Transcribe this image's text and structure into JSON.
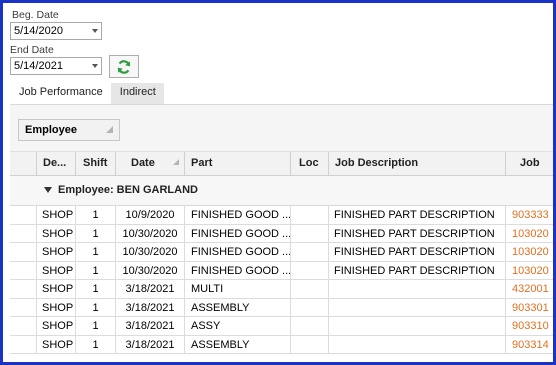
{
  "filters": {
    "beg_date_label": "Beg. Date",
    "beg_date_value": "5/14/2020",
    "end_date_label": "End Date",
    "end_date_value": "5/14/2021"
  },
  "icons": {
    "refresh": "refresh-icon",
    "dropdown": "chevron-down-icon",
    "expand": "triangle-down-icon",
    "sort": "sort-icon"
  },
  "colors": {
    "frame": "#1a33c4",
    "link": "#e07020",
    "refresh_green": "#2e9e3e"
  },
  "tabs": [
    {
      "label": "Job Performance",
      "active": true
    },
    {
      "label": "Indirect",
      "active": false
    }
  ],
  "group_panel": {
    "chip_label": "Employee"
  },
  "grid": {
    "columns": [
      "De...",
      "Shift",
      "Date",
      "Part",
      "Loc",
      "Job Description",
      "Job"
    ],
    "group_row": "Employee: BEN GARLAND",
    "rows": [
      {
        "dept": "SHOP",
        "shift": "1",
        "date": "10/9/2020",
        "part": "FINISHED GOOD ...",
        "loc": "",
        "desc": "FINISHED PART DESCRIPTION",
        "job": "903333"
      },
      {
        "dept": "SHOP",
        "shift": "1",
        "date": "10/30/2020",
        "part": "FINISHED GOOD ...",
        "loc": "",
        "desc": "FINISHED PART DESCRIPTION",
        "job": "103020"
      },
      {
        "dept": "SHOP",
        "shift": "1",
        "date": "10/30/2020",
        "part": "FINISHED GOOD ...",
        "loc": "",
        "desc": "FINISHED PART DESCRIPTION",
        "job": "103020"
      },
      {
        "dept": "SHOP",
        "shift": "1",
        "date": "10/30/2020",
        "part": "FINISHED GOOD ...",
        "loc": "",
        "desc": "FINISHED PART DESCRIPTION",
        "job": "103020"
      },
      {
        "dept": "SHOP",
        "shift": "1",
        "date": "3/18/2021",
        "part": "MULTI",
        "loc": "",
        "desc": "",
        "job": "432001"
      },
      {
        "dept": "SHOP",
        "shift": "1",
        "date": "3/18/2021",
        "part": "ASSEMBLY",
        "loc": "",
        "desc": "",
        "job": "903301"
      },
      {
        "dept": "SHOP",
        "shift": "1",
        "date": "3/18/2021",
        "part": "ASSY",
        "loc": "",
        "desc": "",
        "job": "903310"
      },
      {
        "dept": "SHOP",
        "shift": "1",
        "date": "3/18/2021",
        "part": "ASSEMBLY",
        "loc": "",
        "desc": "",
        "job": "903314"
      }
    ]
  }
}
